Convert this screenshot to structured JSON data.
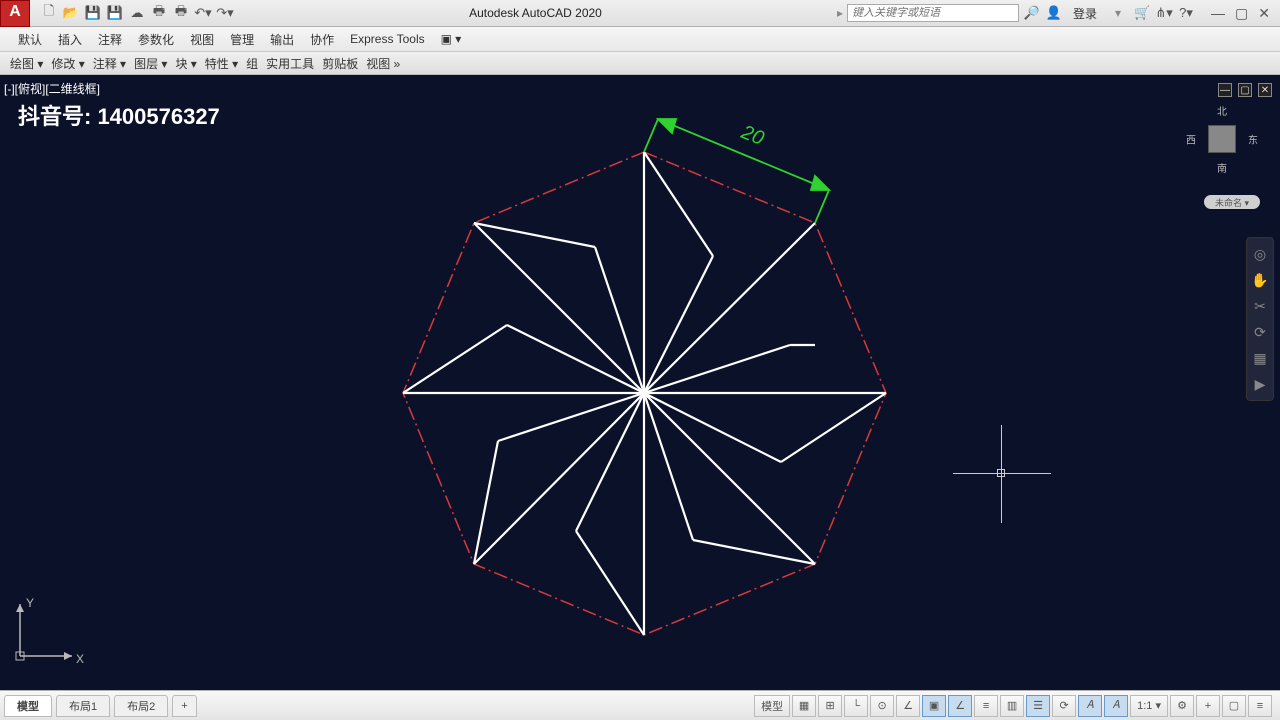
{
  "app": {
    "title": "Autodesk AutoCAD 2020",
    "logo_letter": "A"
  },
  "qat": {
    "search_placeholder": "键入关键字或短语",
    "login": "登录"
  },
  "menubar": [
    "默认",
    "插入",
    "注释",
    "参数化",
    "视图",
    "管理",
    "输出",
    "协作",
    "Express Tools",
    "▣ ▾"
  ],
  "panelbar": [
    "绘图 ▾",
    "修改 ▾",
    "注释 ▾",
    "图层 ▾",
    "块 ▾",
    "特性 ▾",
    "组",
    "实用工具",
    "剪贴板",
    "视图  »"
  ],
  "viewport": {
    "label": "[-][俯视][二维线框]",
    "watermark": "抖音号: 1400576327",
    "compass": {
      "n": "北",
      "s": "南",
      "e": "东",
      "w": "西"
    },
    "unnamed": "未命名 ▾",
    "ucs": {
      "x": "X",
      "y": "Y"
    }
  },
  "drawing": {
    "dimension_value": "20",
    "octagon_color": "#d83a3a",
    "star_color": "#ffffff",
    "dimension_color": "#2fd22f"
  },
  "tabs": {
    "model": "模型",
    "layout1": "布局1",
    "layout2": "布局2",
    "add": "+"
  },
  "status": {
    "model_btn": "模型",
    "grid": "▦",
    "scale": "1:1 ▾"
  }
}
